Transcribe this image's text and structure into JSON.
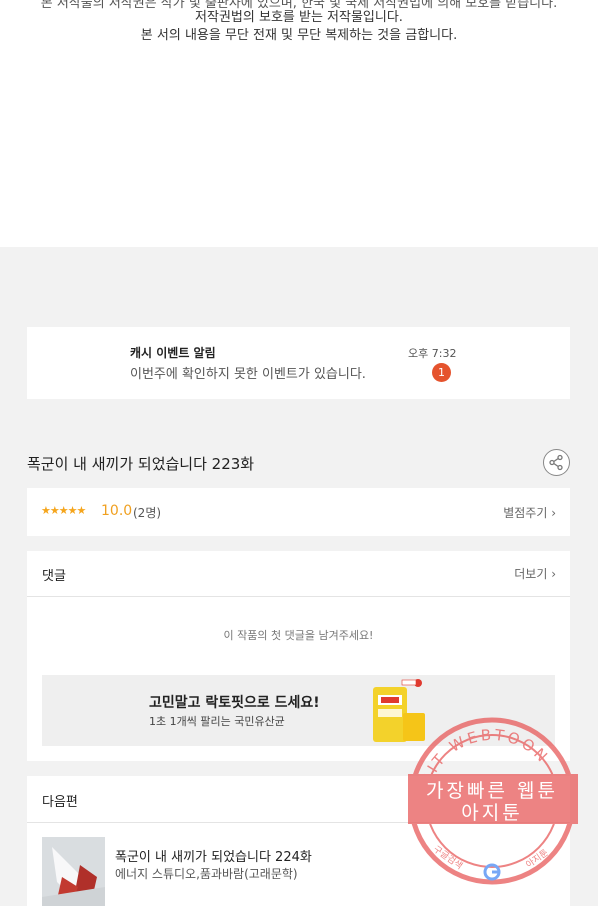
{
  "copyright": {
    "line0": "본 저작물의 저작권은 작가 및 출판사에 있으며, 한국 및 국제 저작권법에 의해 보호를 받습니다.",
    "line1": "저작권법의 보호를 받는 저작물입니다.",
    "line2": "본 서의 내용을 무단 전재 및 무단 복제하는 것을 금합니다."
  },
  "notice": {
    "title": "캐시 이벤트 알림",
    "message": "이번주에 확인하지 못한 이벤트가 있습니다.",
    "time": "오후 7:32",
    "badge": "1"
  },
  "episode": {
    "title": "폭군이 내 새끼가 되었습니다 223화",
    "share_icon": "share-icon"
  },
  "rating": {
    "stars": "★★★★★",
    "score": "10.0",
    "count": "(2명)",
    "give_label": "별점주기 ›"
  },
  "comments": {
    "header": "댓글",
    "more_label": "더보기 ›",
    "empty_text": "이 작품의 첫 댓글을 남겨주세요!",
    "ad": {
      "headline": "고민말고 락토핏으로 드세요!",
      "sub": "1초 1개씩 팔리는 국민유산균"
    }
  },
  "next_episode": {
    "header": "다음편",
    "title": "폭군이 내 새끼가 되었습니다 224화",
    "author": "에너지 스튜디오,품과바람(고래문학)"
  },
  "watermark": {
    "ring_text": "AGIT WEBTOON",
    "line1": "가장빠른 웹툰",
    "line2": "아지툰",
    "footer_left": "구글검색",
    "footer_right": "아지툰"
  },
  "colors": {
    "accent_orange": "#f0a020",
    "badge_red": "#e5532d",
    "stamp_red": "#e85a5a"
  }
}
